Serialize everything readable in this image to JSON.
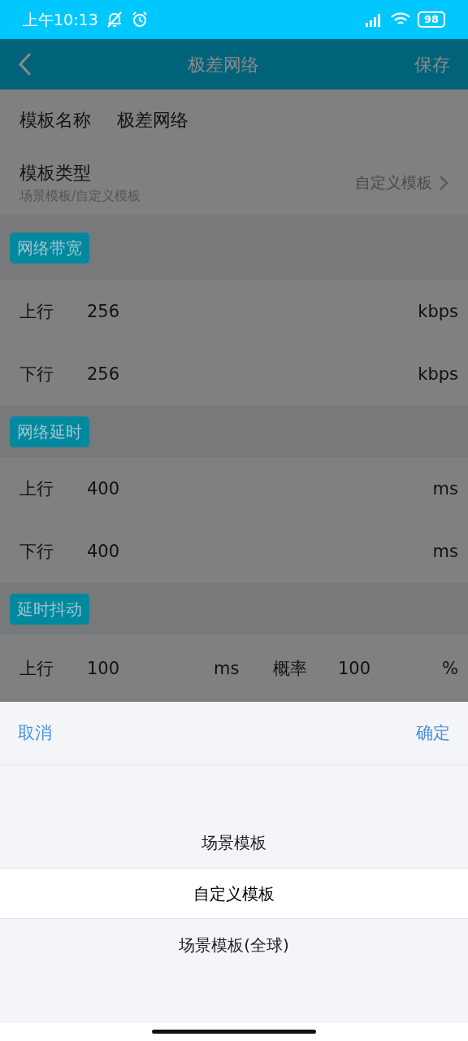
{
  "status_bar": {
    "time": "上午10:13",
    "battery": "98"
  },
  "header": {
    "title": "极差网络",
    "action": "保存"
  },
  "template_name": {
    "label": "模板名称",
    "value": "极差网络"
  },
  "template_type": {
    "label": "模板类型",
    "hint": "场景模板/自定义模板",
    "value": "自定义模板"
  },
  "sections": [
    {
      "title": "网络带宽",
      "rows": [
        {
          "kind": "single",
          "label": "上行",
          "value": "256",
          "unit": "kbps"
        },
        {
          "kind": "single",
          "label": "下行",
          "value": "256",
          "unit": "kbps"
        }
      ]
    },
    {
      "title": "网络延时",
      "rows": [
        {
          "kind": "single",
          "label": "上行",
          "value": "400",
          "unit": "ms"
        },
        {
          "kind": "single",
          "label": "下行",
          "value": "400",
          "unit": "ms"
        }
      ]
    },
    {
      "title": "延时抖动",
      "rows": [
        {
          "kind": "pair",
          "label": "上行",
          "value": "100",
          "unit": "ms",
          "label2": "概率",
          "value2": "100",
          "unit2": "%"
        }
      ]
    }
  ],
  "picker": {
    "cancel": "取消",
    "confirm": "确定",
    "options": [
      {
        "label": "场景模板",
        "selected": false
      },
      {
        "label": "自定义模板",
        "selected": true
      },
      {
        "label": "场景模板(全球)",
        "selected": false
      }
    ]
  }
}
